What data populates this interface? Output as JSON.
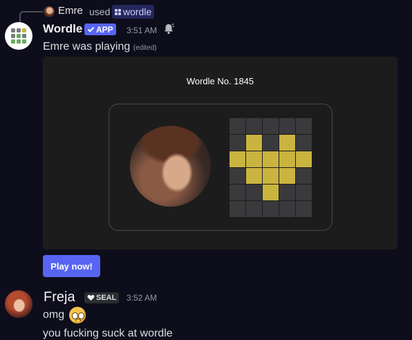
{
  "reply": {
    "user": "Emre",
    "used_text": "used",
    "command": "wordle"
  },
  "message": {
    "author": "Wordle",
    "badge": "APP",
    "timestamp": "3:51 AM",
    "content": "Emre was playing",
    "edited_label": "(edited)",
    "embed": {
      "title": "Wordle No. 1845",
      "grid": [
        [
          "gray",
          "gray",
          "gray",
          "gray",
          "gray"
        ],
        [
          "gray",
          "yellow",
          "gray",
          "yellow",
          "gray"
        ],
        [
          "yellow",
          "yellow",
          "yellow",
          "yellow",
          "yellow"
        ],
        [
          "gray",
          "yellow",
          "yellow",
          "yellow",
          "gray"
        ],
        [
          "gray",
          "gray",
          "yellow",
          "gray",
          "gray"
        ],
        [
          "gray",
          "gray",
          "gray",
          "gray",
          "gray"
        ]
      ]
    },
    "button_label": "Play now!"
  },
  "reply_message": {
    "author": "Freja",
    "badge": "SEAL",
    "timestamp": "3:52 AM",
    "line1": "omg",
    "emoji": "pleading-face-icon",
    "line2": "you fucking suck at wordle"
  },
  "colors": {
    "background": "#0e0d1c",
    "blurple": "#5865f2",
    "tile_yellow": "#c9b43f",
    "tile_gray": "#3a3a3c",
    "embed_bg": "#1c1c1c"
  }
}
